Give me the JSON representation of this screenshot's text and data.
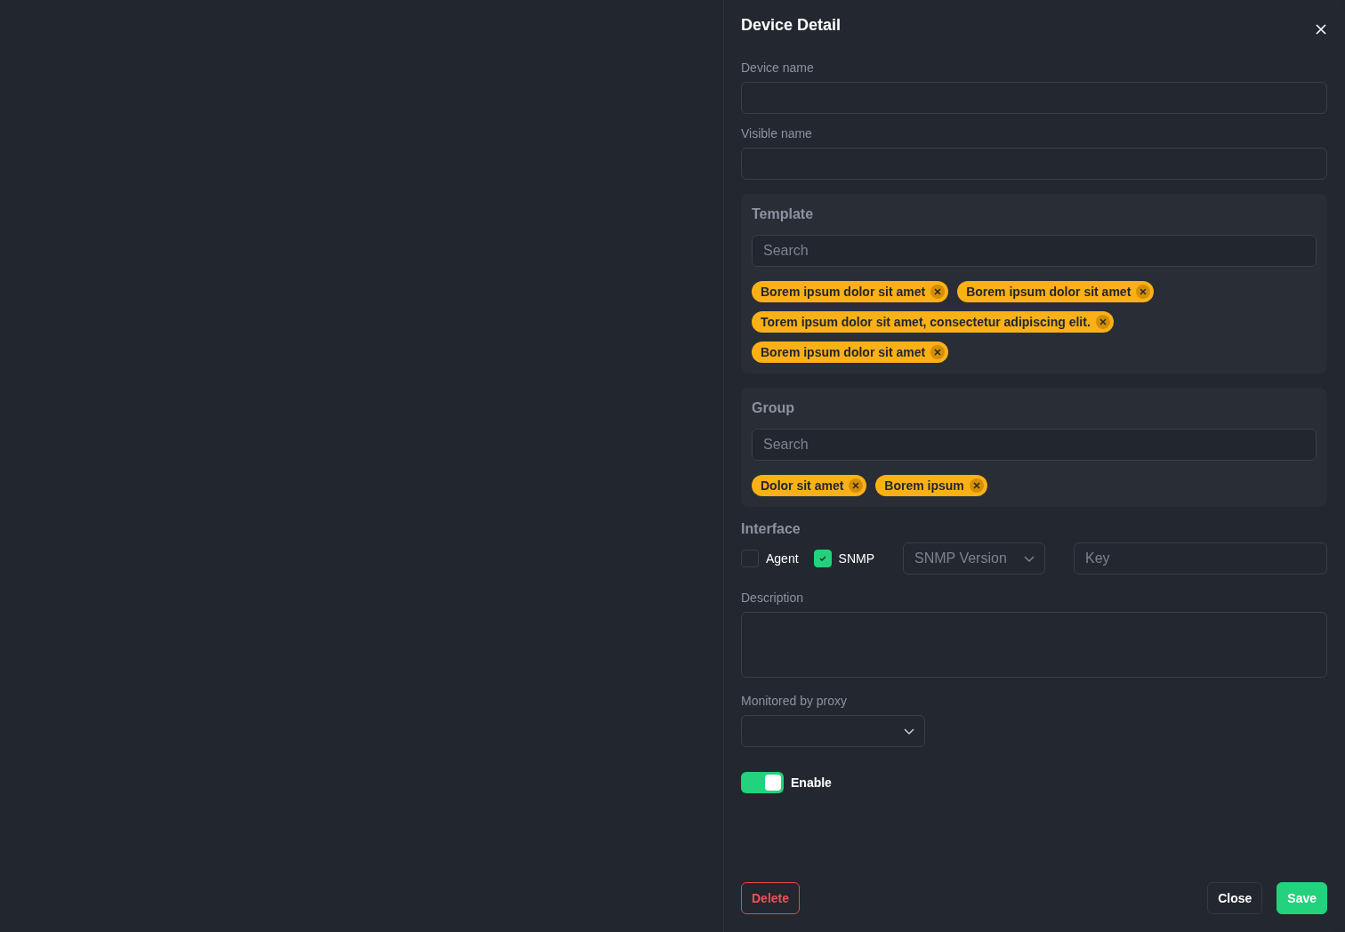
{
  "drawer": {
    "title": "Device Detail"
  },
  "fields": [
    {
      "label": "Device name"
    },
    {
      "label": "Visible name"
    }
  ],
  "sections": [
    {
      "title": "Template",
      "search": {
        "placeholder": "Search"
      },
      "tags": [
        "Borem ipsum dolor sit amet",
        "Borem ipsum dolor sit amet",
        "Torem ipsum dolor sit amet, consectetur adipiscing elit.",
        "Borem ipsum dolor sit amet"
      ]
    },
    {
      "title": "Group",
      "search": {
        "placeholder": "Search"
      },
      "tags": [
        "Dolor sit amet",
        "Borem ipsum"
      ]
    }
  ],
  "interface": {
    "title": "Interface",
    "options": [
      {
        "label": "Agent",
        "checked": false
      },
      {
        "label": "SNMP",
        "checked": true
      }
    ],
    "version_select": {
      "placeholder": "SNMP Version"
    },
    "key": {
      "placeholder": "Key"
    }
  },
  "description": {
    "label": "Description"
  },
  "proxy": {
    "label": "Monitored by proxy"
  },
  "enable": {
    "label": "Enable",
    "on": true
  },
  "buttons": {
    "delete": "Delete",
    "close": "Close",
    "save": "Save"
  }
}
